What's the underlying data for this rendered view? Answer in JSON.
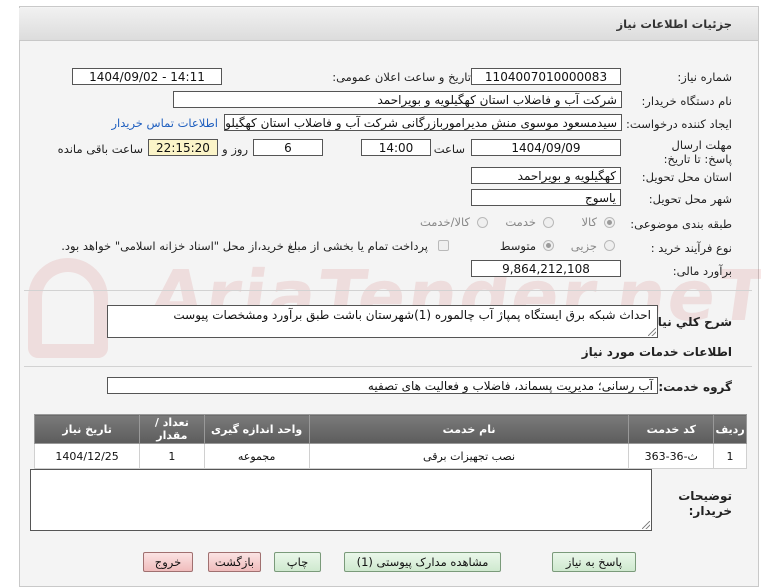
{
  "header": {
    "title": "جزئیات اطلاعات نیاز"
  },
  "fields": {
    "need_number_label": "شماره نیاز:",
    "need_number": "1104007010000083",
    "announce_label": "تاریخ و ساعت اعلان عمومی:",
    "announce_value": "1404/09/02 - 14:11",
    "buyer_org_label": "نام دستگاه خریدار:",
    "buyer_org": "شرکت آب و فاضلاب استان کهگیلویه و بویراحمد",
    "creator_label": "ایجاد کننده درخواست:",
    "creator": "سیدمسعود موسوی منش مدیرامور‌بازرگانی شرکت آب و فاضلاب استان کهگیلویه",
    "contact_link": "اطلاعات تماس خریدار",
    "deadline_label": "مهلت ارسال پاسخ: تا تاریخ:",
    "deadline_date": "1404/09/09",
    "time_label": "ساعت",
    "deadline_time": "14:00",
    "days_value": "6",
    "days_label": "روز و",
    "remaining_time": "22:15:20",
    "remaining_label": "ساعت باقی مانده",
    "province_label": "استان محل تحویل:",
    "province": "کهگیلویه و بویراحمد",
    "city_label": "شهر محل تحویل:",
    "city": "یاسوج",
    "category_label": "طبقه بندی موضوعی:",
    "category_options": [
      "کالا",
      "خدمت",
      "کالا/خدمت"
    ],
    "process_label": "نوع فرآیند خرید :",
    "process_options": [
      "جزیی",
      "متوسط"
    ],
    "payment_note": "پرداخت تمام یا بخشی از مبلغ خرید،از محل \"اسناد خزانه اسلامی\" خواهد بود.",
    "budget_label": "برآورد مالی:",
    "budget": "9,864,212,108"
  },
  "description": {
    "label": "شرح کلي نياز:",
    "text": "احداث شبکه برق ایستگاه پمپاژ آب چالموره (1)شهرستان باشت طبق برآورد ومشخصات پیوست"
  },
  "services": {
    "section_title": "اطلاعات خدمات مورد نياز",
    "group_label": "گروه خدمت:",
    "group_value": "آب رسانی؛ مدیریت پسماند، فاضلاب و فعالیت های تصفیه"
  },
  "table": {
    "headers": [
      "ردیف",
      "کد خدمت",
      "نام خدمت",
      "واحد اندازه گیری",
      "تعداد / مقدار",
      "تاریخ نیاز"
    ],
    "rows": [
      [
        "1",
        "ث-36-363",
        "نصب تجهیزات برقی",
        "مجموعه",
        "1",
        "1404/12/25"
      ]
    ]
  },
  "buyer_notes_label": "توضیحات خریدار:",
  "buttons": {
    "reply": "پاسخ به نیاز",
    "attachments": "مشاهده مدارک پیوستی (1)",
    "print": "چاپ",
    "back": "بازگشت",
    "exit": "خروج"
  },
  "watermark": "AriaTender.neT"
}
